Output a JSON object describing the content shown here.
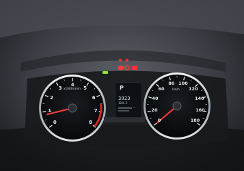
{
  "scene": {
    "description_labels": {
      "tachometer_unit": "x1000r/min",
      "speedometer_unit": "km/h"
    }
  },
  "tachometer": {
    "ticks": [
      "0",
      "1",
      "2",
      "3",
      "4",
      "5",
      "6",
      "7",
      "8"
    ],
    "needle_value": 0.8,
    "redline_start": 6.5
  },
  "speedometer": {
    "ticks": [
      "0",
      "20",
      "40",
      "60",
      "80",
      "100",
      "120",
      "140",
      "160",
      "180"
    ],
    "needle_value": 0
  },
  "center_display": {
    "gear": "P",
    "odometer": "3923",
    "trip": "124.5",
    "temp": "--"
  },
  "colors": {
    "needle": "#ef3b36",
    "dial_face": "#0c0e12",
    "dial_ring": "#cfd3d6",
    "warning_red": "#ff2e2e",
    "warning_green": "#9cff3a"
  }
}
